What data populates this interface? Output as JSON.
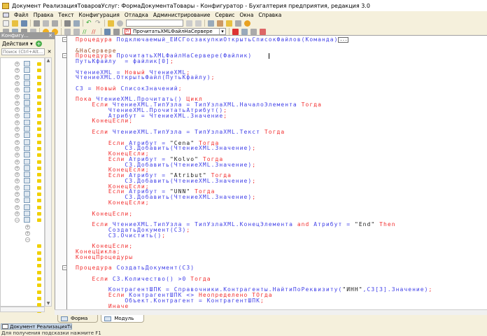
{
  "window": {
    "title": "Документ РеализацияТоваровУслуг: ФормаДокументаТовары - Конфигуратор - Бухгалтерия предприятия, редакция 3.0"
  },
  "menu": [
    "Файл",
    "Правка",
    "Текст",
    "Конфигурация",
    "Отладка",
    "Администрирование",
    "Сервис",
    "Окна",
    "Справка"
  ],
  "toolbar": {
    "search_value": "",
    "procedure_combo": "ПрочитатьXMLФайлНаСервере"
  },
  "left_panel": {
    "title": "Конфигу...",
    "actions_label": "Действия ▾",
    "search_placeholder": "Поиск (Ctrl+Alt...",
    "tree_rows": [
      "full",
      "full",
      "full",
      "full",
      "full",
      "full",
      "full",
      "full",
      "full",
      "full",
      "full",
      "full",
      "full",
      "full",
      "full",
      "full",
      "full",
      "full",
      "full",
      "full",
      "full",
      "full",
      "full",
      "full",
      "open",
      "sub",
      "sub",
      "sub-open",
      "leaf",
      "leaf",
      "leaf",
      "leaf",
      "leaf",
      "leaf",
      "leaf",
      "leaf",
      "leaf",
      "leaf",
      "leaf"
    ]
  },
  "code": [
    [
      [
        "k",
        "Процедура "
      ],
      [
        "i",
        "Подключаемый_ЕИСГосзакупкиОткрытьСписокФайлов(Команда)"
      ]
    ],
    [],
    [
      [
        "p",
        "&НаСервере"
      ]
    ],
    [
      [
        "k",
        "Процедура "
      ],
      [
        "i",
        "ПрочитатьXMLФайлНаСервере(Файлик)"
      ]
    ],
    [
      [
        "i",
        "ПутьКфайлу  = файлик[0]"
      ],
      [
        "k",
        ";"
      ]
    ],
    [],
    [
      [
        "i",
        "ЧтениеXML = "
      ],
      [
        "k",
        "Новый "
      ],
      [
        "i",
        "ЧтениеXML"
      ],
      [
        "k",
        ";"
      ]
    ],
    [
      [
        "i",
        "ЧтениеXML.ОткрытьФайл(ПутьКфайлу)"
      ],
      [
        "k",
        ";"
      ]
    ],
    [],
    [
      [
        "i",
        "СЗ = "
      ],
      [
        "k",
        "Новый "
      ],
      [
        "i",
        "СписокЗначений"
      ],
      [
        "k",
        ";"
      ]
    ],
    [],
    [
      [
        "k",
        "Пока "
      ],
      [
        "i",
        "ЧтениеXML.Прочитать() "
      ],
      [
        "k",
        "Цикл"
      ]
    ],
    [
      [
        "k",
        "    Если "
      ],
      [
        "i",
        "ЧтениеXML.ТипУзла = ТипУзлаXML.НачалоЭлемента "
      ],
      [
        "k",
        "Тогда"
      ]
    ],
    [
      [
        "i",
        "        ЧтениеXML.ПрочитатьАтрибут()"
      ],
      [
        "k",
        ";"
      ]
    ],
    [
      [
        "i",
        "        Атрибут = ЧтениеXML.Значение"
      ],
      [
        "k",
        ";"
      ]
    ],
    [
      [
        "k",
        "    КонецЕсли;"
      ]
    ],
    [],
    [
      [
        "k",
        "    Если "
      ],
      [
        "i",
        "ЧтениеXML.ТипУзла = ТипУзлаXML.Текст "
      ],
      [
        "k",
        "Тогда"
      ]
    ],
    [],
    [
      [
        "k",
        "        Если "
      ],
      [
        "i",
        "Атрибут = "
      ],
      [
        "s",
        "\"Cena\" "
      ],
      [
        "k",
        "Тогда"
      ]
    ],
    [
      [
        "i",
        "            СЗ.Добавить(ЧтениеXML.Значение)"
      ],
      [
        "k",
        ";"
      ]
    ],
    [
      [
        "k",
        "        КонецЕсли;"
      ]
    ],
    [
      [
        "k",
        "        Если "
      ],
      [
        "i",
        "Атрибут = "
      ],
      [
        "s",
        "\"Kolvo\" "
      ],
      [
        "k",
        "Тогда"
      ]
    ],
    [
      [
        "i",
        "            СЗ.Добавить(ЧтениеXML.Значение)"
      ],
      [
        "k",
        ";"
      ]
    ],
    [
      [
        "k",
        "        КонецЕсли;"
      ]
    ],
    [
      [
        "k",
        "        Если "
      ],
      [
        "i",
        "Атрибут = "
      ],
      [
        "s",
        "\"Atribut\" "
      ],
      [
        "k",
        "Тогда"
      ]
    ],
    [
      [
        "i",
        "            СЗ.Добавить(ЧтениеXML.Значение)"
      ],
      [
        "k",
        ";"
      ]
    ],
    [
      [
        "k",
        "        КонецЕсли;"
      ]
    ],
    [
      [
        "k",
        "        Если "
      ],
      [
        "i",
        "Атрибут = "
      ],
      [
        "s",
        "\"UNN\" "
      ],
      [
        "k",
        "Тогда"
      ]
    ],
    [
      [
        "i",
        "            СЗ.Добавить(ЧтениеXML.Значение)"
      ],
      [
        "k",
        ";"
      ]
    ],
    [
      [
        "k",
        "        КонецЕсли;"
      ]
    ],
    [],
    [
      [
        "k",
        "    КонецЕсли;"
      ]
    ],
    [],
    [
      [
        "k",
        "    Если "
      ],
      [
        "i",
        "ЧтениеXML.ТипУзла = ТипУзлаXML.КонецЭлемента "
      ],
      [
        "k",
        "and "
      ],
      [
        "i",
        "Атрибут = "
      ],
      [
        "s",
        "\"End\" "
      ],
      [
        "k",
        "Then"
      ]
    ],
    [
      [
        "i",
        "        СоздатьДокумент(СЗ)"
      ],
      [
        "k",
        ";"
      ]
    ],
    [
      [
        "i",
        "        СЗ.Очистить()"
      ],
      [
        "k",
        ";"
      ]
    ],
    [],
    [
      [
        "k",
        "    КонецЕсли;"
      ]
    ],
    [
      [
        "k",
        "КонецЦикла;"
      ]
    ],
    [
      [
        "k",
        "КонецПроцедуры"
      ]
    ],
    [],
    [
      [
        "k",
        "Процедура "
      ],
      [
        "i",
        "СоздатьДокумент(СЗ)"
      ]
    ],
    [],
    [
      [
        "k",
        "    Если "
      ],
      [
        "i",
        "СЗ.Количество() >0 "
      ],
      [
        "k",
        "Тогда"
      ]
    ],
    [],
    [
      [
        "i",
        "        КонтрагентШПК = Справочники.Контрагенты.НайтиПоРеквизиту("
      ],
      [
        "s",
        "\"ИНН\""
      ],
      [
        "i",
        ",СЗ[3].Значение)"
      ],
      [
        "k",
        ";"
      ]
    ],
    [
      [
        "k",
        "        Если "
      ],
      [
        "i",
        "КонтрагентШПК <> "
      ],
      [
        "k",
        "Неопределено ТОгда"
      ]
    ],
    [
      [
        "i",
        "            Объект.Контрагент = КонтрагентШПК"
      ],
      [
        "k",
        ";"
      ]
    ],
    [
      [
        "k",
        "        Иначе"
      ]
    ]
  ],
  "fold_lines": [
    0,
    3,
    42
  ],
  "tabs": [
    {
      "label": "Форма"
    },
    {
      "label": "Модуль"
    }
  ],
  "taskbar": {
    "window_label": "Документ РеализацияТова..."
  },
  "status": "Для получения подсказки нажмите F1"
}
